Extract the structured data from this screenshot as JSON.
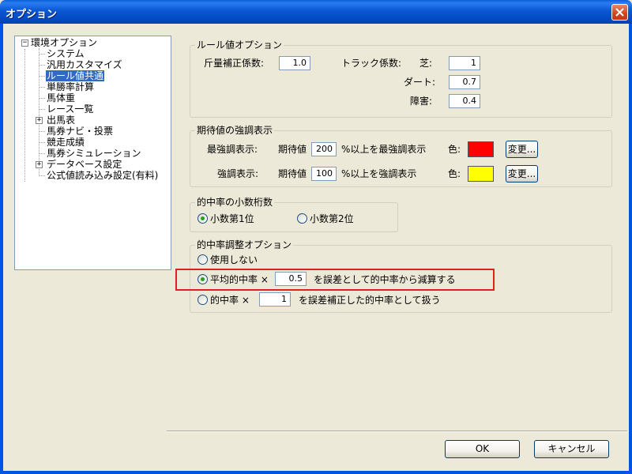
{
  "window": {
    "title": "オプション"
  },
  "tree": {
    "items": [
      {
        "label": "環境オプション"
      },
      {
        "label": "システム"
      },
      {
        "label": "汎用カスタマイズ"
      },
      {
        "label": "ルール値共通"
      },
      {
        "label": "単勝率計算"
      },
      {
        "label": "馬体重"
      },
      {
        "label": "レース一覧"
      },
      {
        "label": "出馬表"
      },
      {
        "label": "馬券ナビ・投票"
      },
      {
        "label": "競走成績"
      },
      {
        "label": "馬券シミュレーション"
      },
      {
        "label": "データベース設定"
      },
      {
        "label": "公式値読み込み設定(有料)"
      }
    ],
    "selected_index": 3
  },
  "rule_options": {
    "legend": "ルール値オプション",
    "weight_label": "斤量補正係数:",
    "weight_value": "1.0",
    "track_label": "トラック係数:",
    "turf_label": "芝:",
    "turf_value": "1",
    "dirt_label": "ダート:",
    "dirt_value": "0.7",
    "hurdle_label": "障害:",
    "hurdle_value": "0.4"
  },
  "emphasis": {
    "legend": "期待値の強調表示",
    "strong_label": "最強調表示:",
    "strong_prefix": "期待値",
    "strong_value": "200",
    "strong_suffix": "%以上を最強調表示",
    "normal_label": "強調表示:",
    "normal_prefix": "期待値",
    "normal_value": "100",
    "normal_suffix": "%以上を強調表示",
    "color_label": "色:",
    "change_label": "変更...",
    "strong_color": "#ff0000",
    "normal_color": "#ffff00"
  },
  "decimals": {
    "legend": "的中率の小数桁数",
    "option1": "小数第1位",
    "option2": "小数第2位"
  },
  "adjust": {
    "legend": "的中率調整オプション",
    "option_none": "使用しない",
    "option_avg_prefix": "平均的中率 ×",
    "option_avg_value": "0.5",
    "option_avg_suffix": "を誤差として的中率から減算する",
    "option_rate_prefix": "的中率 ×",
    "option_rate_value": "1",
    "option_rate_suffix": "を誤差補正した的中率として扱う"
  },
  "footer": {
    "ok_label": "OK",
    "cancel_label": "キャンセル"
  }
}
